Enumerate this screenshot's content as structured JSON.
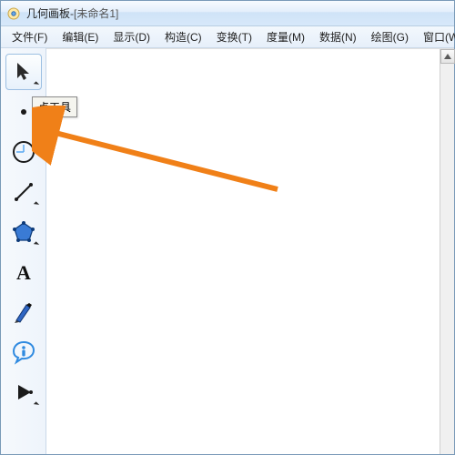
{
  "title": {
    "app": "几何画板",
    "sep": " - ",
    "doc": "[未命名1]"
  },
  "menus": [
    "文件(F)",
    "编辑(E)",
    "显示(D)",
    "构造(C)",
    "变换(T)",
    "度量(M)",
    "数据(N)",
    "绘图(G)",
    "窗口(W)"
  ],
  "tools": {
    "select": "选择工具",
    "point": "点工具",
    "compass": "圆规工具",
    "line": "线工具",
    "polygon": "多边形工具",
    "text": "文本工具",
    "marker": "标记工具",
    "info": "信息工具",
    "custom": "自定义工具"
  },
  "tooltip": {
    "point_tool": "点工具"
  },
  "annotation": {
    "color": "#f08018"
  }
}
